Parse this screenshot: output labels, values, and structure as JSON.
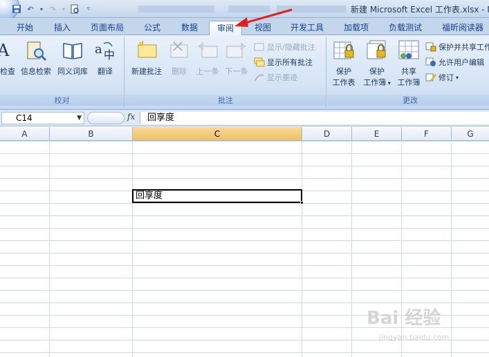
{
  "window": {
    "title": "新建 Microsoft Excel 工作表.xlsx - M"
  },
  "tabs": [
    {
      "label": "开始"
    },
    {
      "label": "插入"
    },
    {
      "label": "页面布局"
    },
    {
      "label": "公式"
    },
    {
      "label": "数据"
    },
    {
      "label": "审阅"
    },
    {
      "label": "视图"
    },
    {
      "label": "开发工具"
    },
    {
      "label": "加载项"
    },
    {
      "label": "负载测试"
    },
    {
      "label": "福昕阅读器"
    }
  ],
  "active_tab": "审阅",
  "ribbon": {
    "proofing": {
      "label": "校对",
      "buttons": [
        {
          "label": "检查",
          "icon": "spelling-icon"
        },
        {
          "label": "信息检索",
          "icon": "research-icon"
        },
        {
          "label": "同义词库",
          "icon": "thesaurus-icon"
        },
        {
          "label": "翻译",
          "icon": "translate-icon"
        }
      ]
    },
    "comments": {
      "label": "批注",
      "buttons": [
        {
          "label": "新建批注",
          "icon": "new-comment-icon",
          "enabled": true
        },
        {
          "label": "删除",
          "icon": "delete-comment-icon",
          "enabled": false
        },
        {
          "label": "上一条",
          "icon": "previous-comment-icon",
          "enabled": false
        },
        {
          "label": "下一条",
          "icon": "next-comment-icon",
          "enabled": false
        }
      ],
      "small": [
        {
          "label": "显示/隐藏批注",
          "enabled": false
        },
        {
          "label": "显示所有批注",
          "enabled": true
        },
        {
          "label": "显示墨迹",
          "enabled": false
        }
      ]
    },
    "changes": {
      "label": "更改",
      "buttons": [
        {
          "label1": "保护",
          "label2": "工作表",
          "icon": "protect-sheet-icon"
        },
        {
          "label1": "保护",
          "label2": "工作簿",
          "icon": "protect-workbook-icon"
        },
        {
          "label1": "共享",
          "label2": "工作簿",
          "icon": "share-workbook-icon"
        }
      ],
      "small": [
        {
          "label": "保护并共享工作"
        },
        {
          "label": "允许用户编辑"
        },
        {
          "label": "修订"
        }
      ]
    }
  },
  "formula_bar": {
    "name_box": "C14",
    "fx": "fx",
    "content": "回享度"
  },
  "columns": [
    "A",
    "B",
    "C",
    "D",
    "E",
    "F",
    "G"
  ],
  "selected_column": "C",
  "active_cell": {
    "ref": "C14",
    "value": "回享度"
  },
  "watermark": {
    "text": "Bai 经验",
    "sub": "jingyan.baidu.com"
  }
}
